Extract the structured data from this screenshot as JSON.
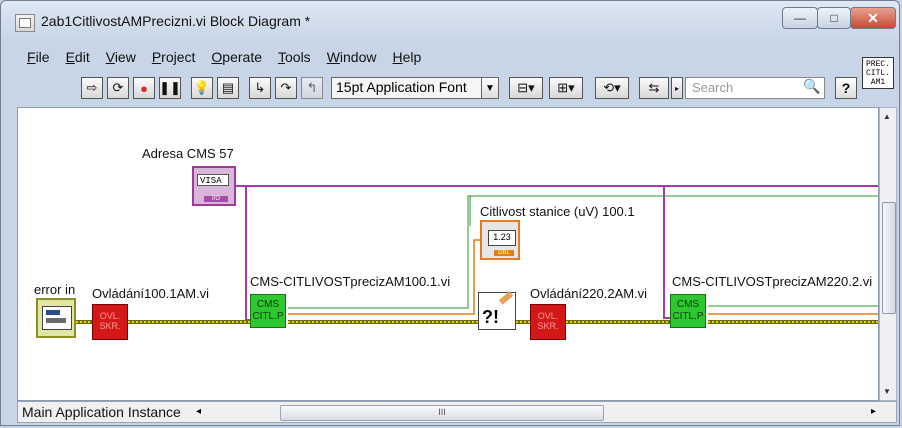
{
  "window": {
    "title": "2ab1CitlivostAMPrecizni.vi Block Diagram *",
    "controls": {
      "minimize": "—",
      "maximize": "□",
      "close": "✕"
    }
  },
  "menu": {
    "items": [
      {
        "label": "File",
        "key": "F"
      },
      {
        "label": "Edit",
        "key": "E"
      },
      {
        "label": "View",
        "key": "V"
      },
      {
        "label": "Project",
        "key": "P"
      },
      {
        "label": "Operate",
        "key": "O"
      },
      {
        "label": "Tools",
        "key": "T"
      },
      {
        "label": "Window",
        "key": "W"
      },
      {
        "label": "Help",
        "key": "H"
      }
    ]
  },
  "toolbar": {
    "font_select": "15pt Application Font",
    "search_placeholder": "Search",
    "help_label": "?"
  },
  "vi_icon": {
    "line1": "PREC.",
    "line2": "CITL.",
    "line3": "AM1"
  },
  "diagram": {
    "adresa_label": "Adresa CMS 57",
    "visa_text": "VISA",
    "citlivost_label": "Citlivost stanice (uV) 100.1",
    "indicator_value": "1.23",
    "error_in_label": "error in",
    "ovladani1_label": "Ovládání100.1AM.vi",
    "ovladani2_label": "Ovládání220.2AM.vi",
    "cms1_label": "CMS-CITLIVOSTprecizAM100.1.vi",
    "cms2_label": "CMS-CITLIVOSTprecizAM220.2.vi",
    "red_node_text": "OVL.\nSKR.",
    "green_node_text": "CMS\nCITL.P",
    "handler_text": "?!"
  },
  "statusbar": {
    "instance": "Main Application Instance",
    "scroll_grip": "III"
  }
}
